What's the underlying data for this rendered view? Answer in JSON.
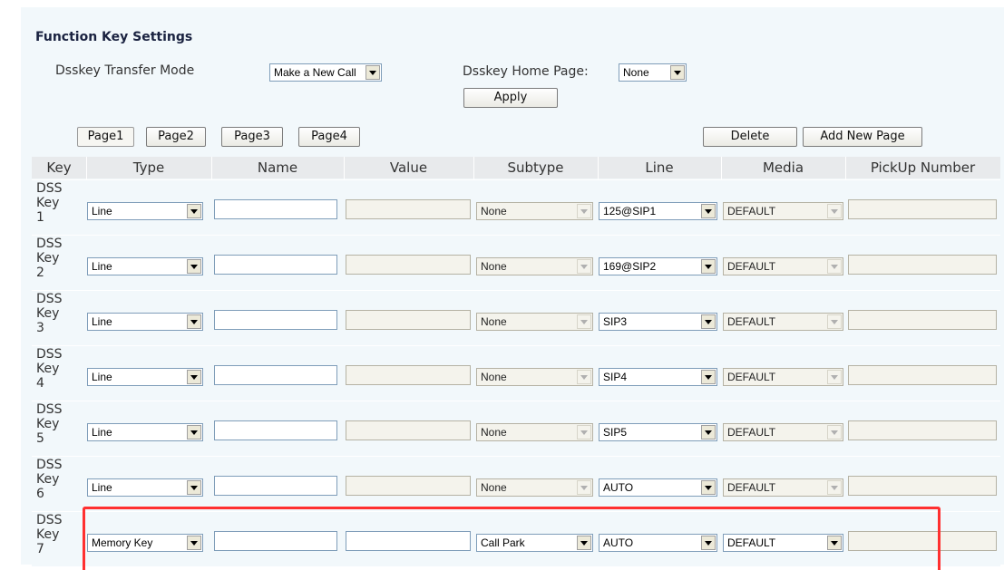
{
  "section_title": "Function Key Settings",
  "transfer_mode": {
    "label": "Dsskey Transfer Mode",
    "value": "Make a New Call"
  },
  "home_page": {
    "label": "Dsskey Home Page:",
    "value": "None"
  },
  "apply_label": "Apply",
  "tabs": [
    "Page1",
    "Page2",
    "Page3",
    "Page4"
  ],
  "delete_label": "Delete",
  "add_page_label": "Add New Page",
  "columns": [
    "Key",
    "Type",
    "Name",
    "Value",
    "Subtype",
    "Line",
    "Media",
    "PickUp Number"
  ],
  "rows": [
    {
      "key": [
        "DSS",
        "Key",
        "1"
      ],
      "type": "Line",
      "subtype": "None",
      "line": "125@SIP1",
      "media": "DEFAULT"
    },
    {
      "key": [
        "DSS",
        "Key",
        "2"
      ],
      "type": "Line",
      "subtype": "None",
      "line": "169@SIP2",
      "media": "DEFAULT"
    },
    {
      "key": [
        "DSS",
        "Key",
        "3"
      ],
      "type": "Line",
      "subtype": "None",
      "line": "SIP3",
      "media": "DEFAULT"
    },
    {
      "key": [
        "DSS",
        "Key",
        "4"
      ],
      "type": "Line",
      "subtype": "None",
      "line": "SIP4",
      "media": "DEFAULT"
    },
    {
      "key": [
        "DSS",
        "Key",
        "5"
      ],
      "type": "Line",
      "subtype": "None",
      "line": "SIP5",
      "media": "DEFAULT"
    },
    {
      "key": [
        "DSS",
        "Key",
        "6"
      ],
      "type": "Line",
      "subtype": "None",
      "line": "AUTO",
      "media": "DEFAULT"
    },
    {
      "key": [
        "DSS",
        "Key",
        "7"
      ],
      "type": "Memory Key",
      "subtype": "Call Park",
      "line": "AUTO",
      "media": "DEFAULT"
    }
  ],
  "highlight_color": "#ff3030",
  "icons": {
    "dropdown": "chevron-down-icon"
  }
}
